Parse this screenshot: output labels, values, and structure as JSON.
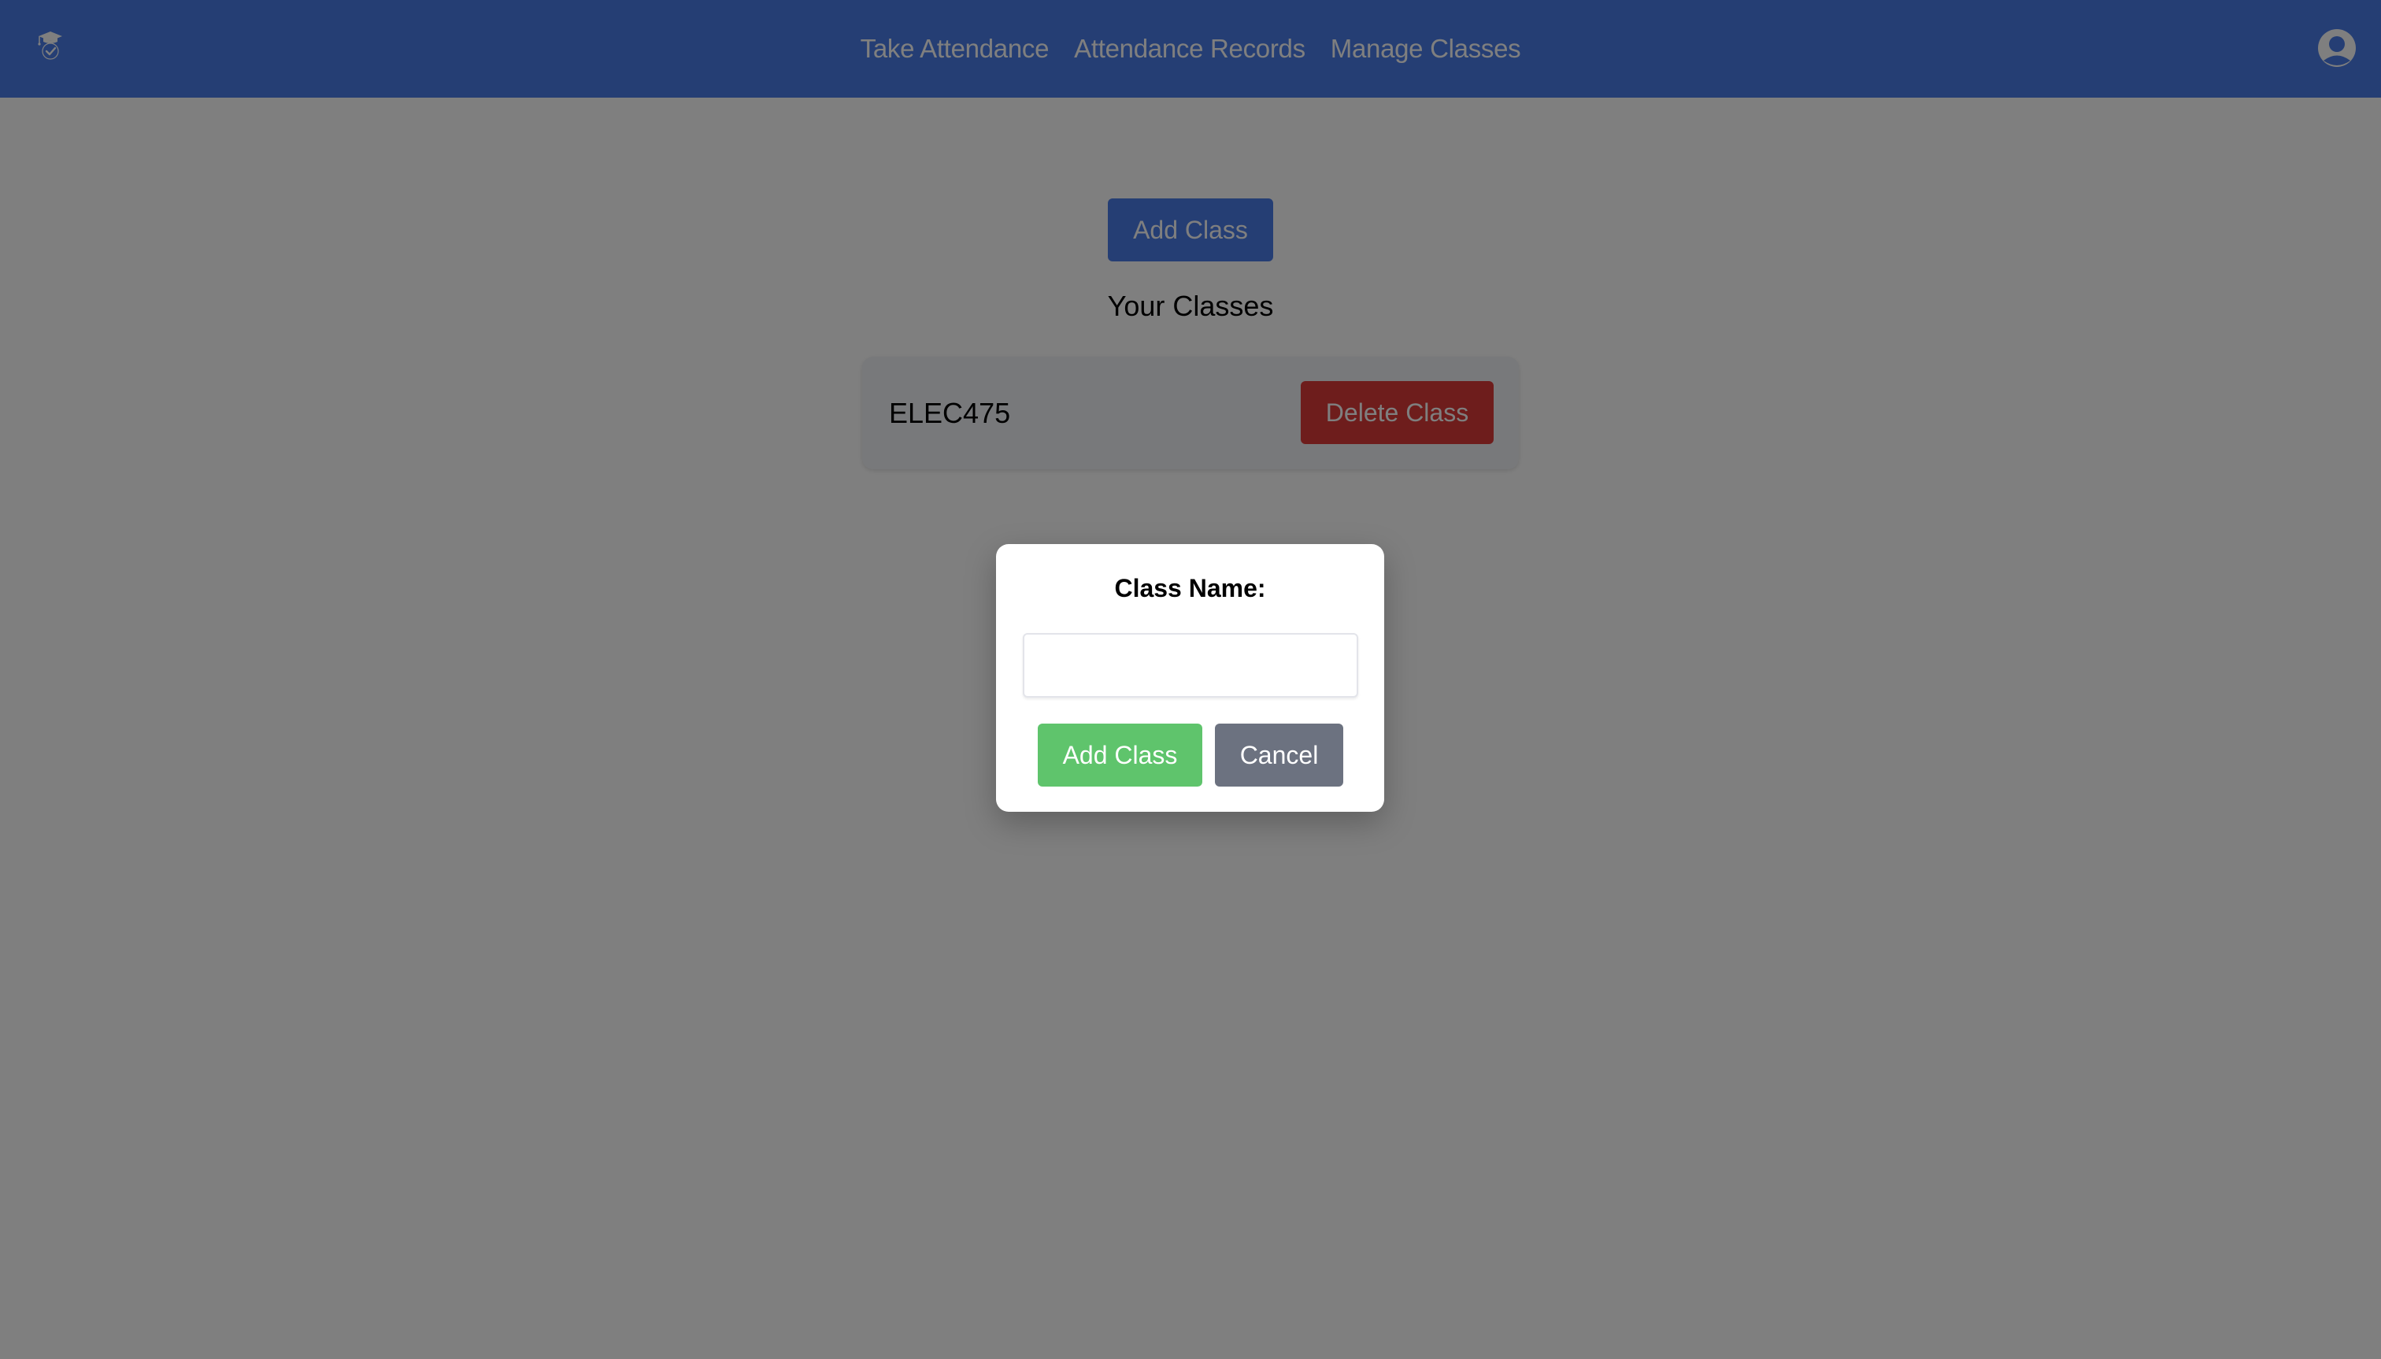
{
  "navbar": {
    "logo_icon": "graduation-cap-check-icon",
    "links": [
      {
        "label": "Take Attendance"
      },
      {
        "label": "Attendance Records"
      },
      {
        "label": "Manage Classes"
      }
    ],
    "avatar_icon": "user-avatar-icon"
  },
  "main": {
    "add_class_label": "Add Class",
    "section_title": "Your Classes",
    "classes": [
      {
        "name": "ELEC475",
        "delete_label": "Delete Class"
      }
    ]
  },
  "modal": {
    "label": "Class Name:",
    "input_value": "",
    "input_placeholder": "",
    "add_label": "Add Class",
    "cancel_label": "Cancel"
  },
  "colors": {
    "primary": "#4a7de8",
    "danger": "#dc3a38",
    "success": "#5fc46c",
    "secondary": "#6c7280",
    "overlay": "rgba(0,0,0,0.5)"
  }
}
